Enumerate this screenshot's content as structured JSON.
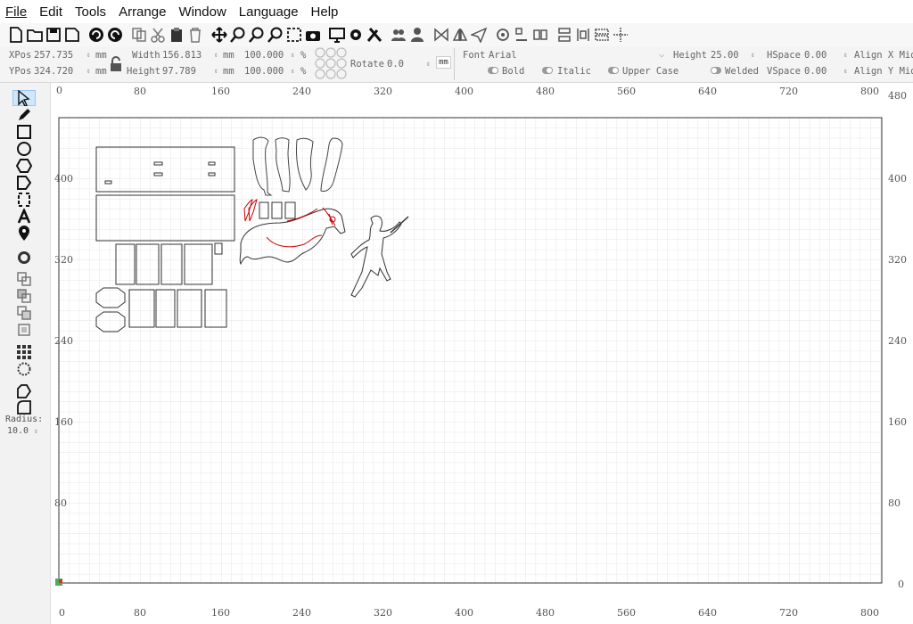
{
  "menu": [
    "File",
    "Edit",
    "Tools",
    "Arrange",
    "Window",
    "Language",
    "Help"
  ],
  "props": {
    "xpos_label": "XPos",
    "xpos": "257.735",
    "ypos_label": "YPos",
    "ypos": "324.720",
    "unit": "mm",
    "width_label": "Width",
    "width": "156.813",
    "height_label": "Height",
    "height": "97.789",
    "scale_x": "100.000",
    "scale_y": "100.000",
    "percent": "%",
    "rotate_label": "Rotate",
    "rotate": "0.0",
    "mm_button": "mm",
    "font_label": "Font",
    "font": "Arial",
    "text_height_label": "Height",
    "text_height": "25.00",
    "hspace_label": "HSpace",
    "hspace": "0.00",
    "vspace_label": "VSpace",
    "vspace": "0.00",
    "align_x": "Align X Mid",
    "align_y": "Align Y Mid",
    "bold": "Bold",
    "italic": "Italic",
    "upper_case": "Upper Case",
    "welded": "Welded"
  },
  "sidebar": {
    "radius_label": "Radius:",
    "radius_value": "10.0"
  },
  "rulers": {
    "x_ticks": [
      "0",
      "80",
      "160",
      "240",
      "320",
      "400",
      "480",
      "560",
      "640",
      "720",
      "800"
    ],
    "y_ticks": [
      "480",
      "400",
      "320",
      "240",
      "160",
      "80",
      "0"
    ]
  },
  "colors": {
    "accent": "#e11d1d",
    "workspace": "#ffffff",
    "grid": "#e4e4e4",
    "ui": "#f0f0f0"
  }
}
